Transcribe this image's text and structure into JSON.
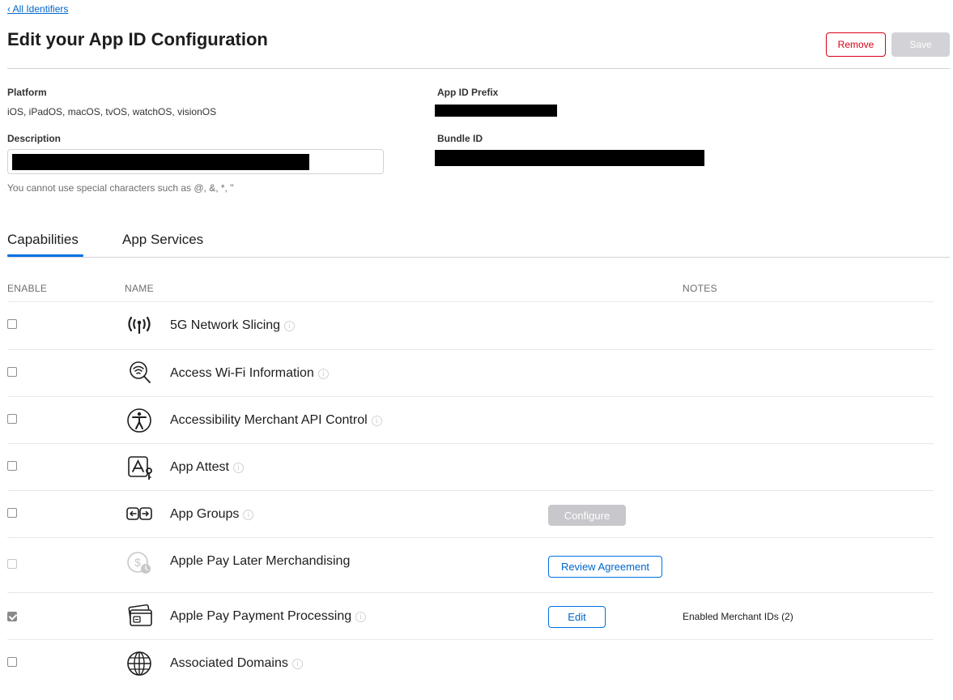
{
  "header": {
    "back_link": "‹ All Identifiers",
    "title": "Edit your App ID Configuration",
    "remove_label": "Remove",
    "save_label": "Save"
  },
  "fields": {
    "platform_label": "Platform",
    "platform_value": "iOS, iPadOS, macOS, tvOS, watchOS, visionOS",
    "description_label": "Description",
    "description_hint": "You cannot use special characters such as @, &, *, \"",
    "app_id_prefix_label": "App ID Prefix",
    "bundle_id_label": "Bundle ID"
  },
  "tabs": [
    {
      "label": "Capabilities",
      "active": true
    },
    {
      "label": "App Services",
      "active": false
    }
  ],
  "table": {
    "headers": {
      "enable": "ENABLE",
      "name": "NAME",
      "notes": "NOTES"
    },
    "rows": [
      {
        "name": "5G Network Slicing",
        "icon": "antenna-signal-icon",
        "checked": false,
        "disabled": false,
        "info": true
      },
      {
        "name": "Access Wi-Fi Information",
        "icon": "wifi-magnifier-icon",
        "checked": false,
        "disabled": false,
        "info": true
      },
      {
        "name": "Accessibility Merchant API Control",
        "icon": "accessibility-icon",
        "checked": false,
        "disabled": false,
        "info": true
      },
      {
        "name": "App Attest",
        "icon": "app-attest-icon",
        "checked": false,
        "disabled": false,
        "info": true
      },
      {
        "name": "App Groups",
        "icon": "app-groups-icon",
        "checked": false,
        "disabled": false,
        "info": true,
        "button": "Configure"
      },
      {
        "name": "Apple Pay Later Merchandising",
        "icon": "pay-later-icon",
        "checked": false,
        "disabled": true,
        "info": false,
        "button": "Review Agreement"
      },
      {
        "name": "Apple Pay Payment Processing",
        "icon": "payment-card-icon",
        "checked": true,
        "disabled": false,
        "info": true,
        "button": "Edit",
        "note": "Enabled Merchant IDs (2)"
      },
      {
        "name": "Associated Domains",
        "icon": "globe-icon",
        "checked": false,
        "disabled": false,
        "info": true
      }
    ]
  },
  "colors": {
    "link": "#0066cc",
    "remove": "#d70015",
    "accent": "#0071e3",
    "disabled_button": "#c7c7cc"
  }
}
